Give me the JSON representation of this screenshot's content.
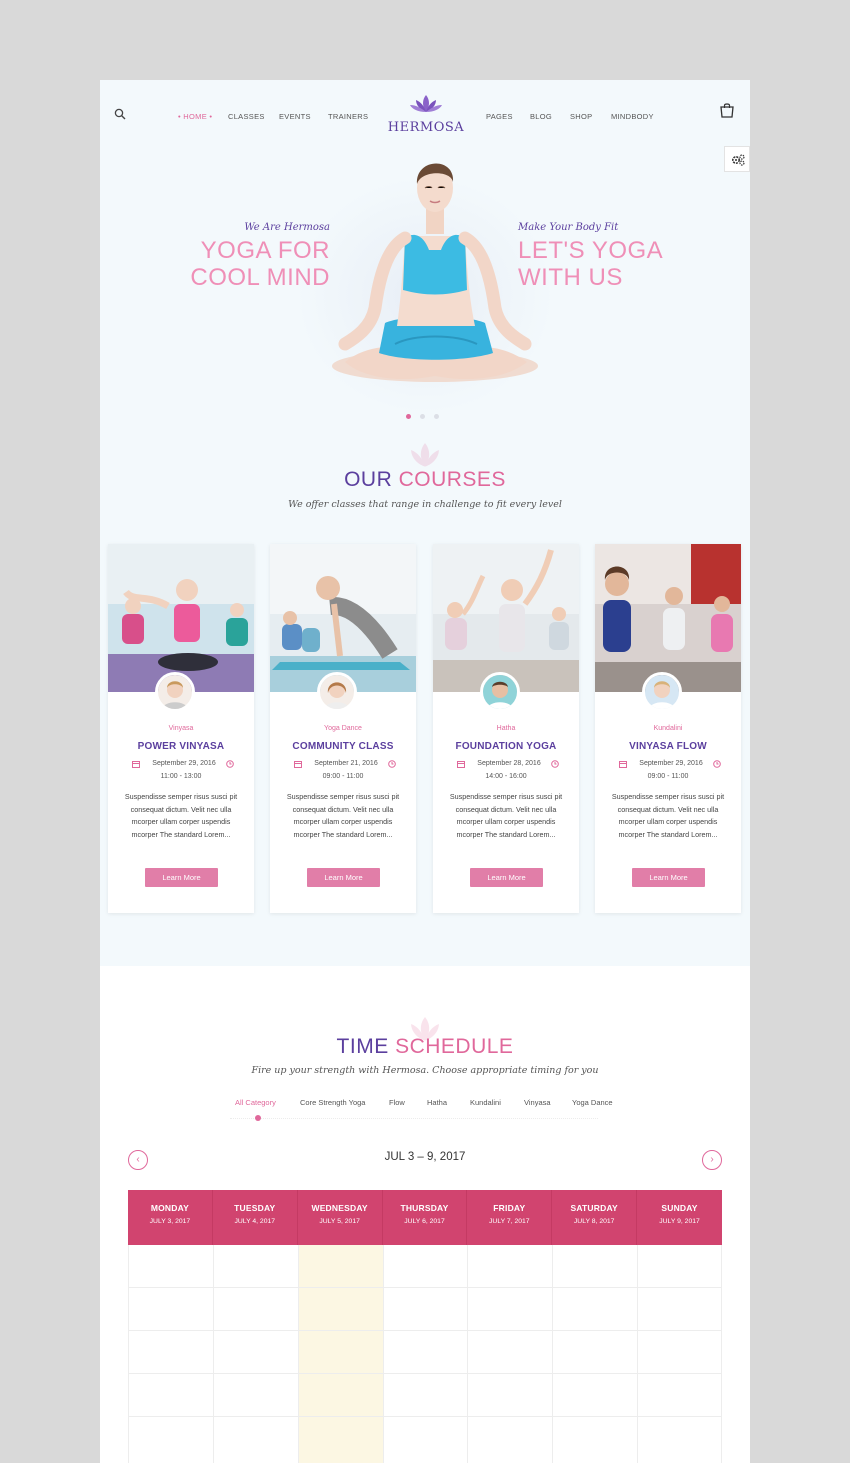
{
  "nav": {
    "left_items": [
      "• HOME •",
      "CLASSES",
      "EVENTS",
      "TRAINERS"
    ],
    "right_items": [
      "PAGES",
      "BLOG",
      "SHOP",
      "MINDBODY"
    ],
    "logo": "HERMOSA"
  },
  "hero": {
    "left_tag": "We Are Hermosa",
    "left_line1": "YOGA FOR",
    "left_line2": "COOL MIND",
    "right_tag": "Make Your Body Fit",
    "right_line1": "LET'S YOGA",
    "right_line2": "WITH US"
  },
  "courses": {
    "title_a": "OUR",
    "title_b": "COURSES",
    "subtitle": "We offer classes that range in challenge to fit every level",
    "cards": [
      {
        "cat": "Vinyasa",
        "title": "POWER VINYASA",
        "date": "September 29, 2016",
        "time": "11:00 - 13:00",
        "desc": "Suspendisse semper risus susci pit consequat dictum. Velit nec ulla mcorper ullam corper uspendis mcorper The standard Lorem...",
        "btn": "Learn More"
      },
      {
        "cat": "Yoga Dance",
        "title": "COMMUNITY CLASS",
        "date": "September 21, 2016",
        "time": "09:00 - 11:00",
        "desc": "Suspendisse semper risus susci pit consequat dictum. Velit nec ulla mcorper ullam corper uspendis mcorper The standard Lorem...",
        "btn": "Learn More"
      },
      {
        "cat": "Hatha",
        "title": "FOUNDATION YOGA",
        "date": "September 28, 2016",
        "time": "14:00 - 16:00",
        "desc": "Suspendisse semper risus susci pit consequat dictum. Velit nec ulla mcorper ullam corper uspendis mcorper The standard Lorem...",
        "btn": "Learn More"
      },
      {
        "cat": "Kundalini",
        "title": "VINYASA FLOW",
        "date": "September 29, 2016",
        "time": "09:00 - 11:00",
        "desc": "Suspendisse semper risus susci pit consequat dictum. Velit nec ulla mcorper ullam corper uspendis mcorper The standard Lorem...",
        "btn": "Learn More"
      }
    ]
  },
  "schedule": {
    "title_a": "TIME",
    "title_b": "SCHEDULE",
    "subtitle": "Fire up your strength with Hermosa. Choose appropriate timing for you",
    "filters": [
      "All Category",
      "Core Strength Yoga",
      "Flow",
      "Hatha",
      "Kundalini",
      "Vinyasa",
      "Yoga Dance"
    ],
    "week": "JUL 3 – 9, 2017",
    "prev": "‹",
    "next": "›",
    "days": [
      {
        "name": "MONDAY",
        "date": "JULY 3, 2017"
      },
      {
        "name": "TUESDAY",
        "date": "JULY 4, 2017"
      },
      {
        "name": "WEDNESDAY",
        "date": "JULY 5, 2017"
      },
      {
        "name": "THURSDAY",
        "date": "JULY 6, 2017"
      },
      {
        "name": "FRIDAY",
        "date": "JULY 7, 2017"
      },
      {
        "name": "SATURDAY",
        "date": "JULY 8, 2017"
      },
      {
        "name": "SUNDAY",
        "date": "JULY 9, 2017"
      }
    ]
  },
  "colors": {
    "purple": "#5b3f9e",
    "pink": "#e0689b",
    "header_pink": "#d1446f"
  },
  "icons": [
    "search-icon",
    "lotus-logo-icon",
    "cart-icon",
    "gear-icon",
    "calendar-icon",
    "clock-icon"
  ]
}
